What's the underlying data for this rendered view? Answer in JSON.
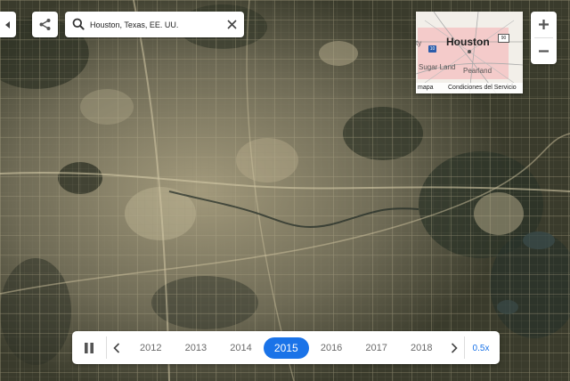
{
  "colors": {
    "accent": "#1a73e8",
    "minimap_city": "#f4c4c4"
  },
  "nav": {
    "back_icon": "caret-left-icon",
    "share_icon": "share-icon"
  },
  "search": {
    "value": "Houston, Texas, EE. UU.",
    "icon": "search-icon",
    "clear_icon": "close-icon"
  },
  "minimap": {
    "city_label": "Houston",
    "places": [
      "Sugar Land",
      "Pearland",
      "ty"
    ],
    "highway_shields": [
      "10",
      "90"
    ],
    "footer_attrib": "mapa",
    "footer_terms": "Condiciones del Servicio"
  },
  "zoom": {
    "in_label": "+",
    "out_label": "−"
  },
  "timeline": {
    "pause_icon": "pause-icon",
    "prev_icon": "chevron-left-icon",
    "next_icon": "chevron-right-icon",
    "years": [
      "2012",
      "2013",
      "2014",
      "2015",
      "2016",
      "2017",
      "2018"
    ],
    "selected_year": "2015",
    "speed_label": "0.5x"
  }
}
